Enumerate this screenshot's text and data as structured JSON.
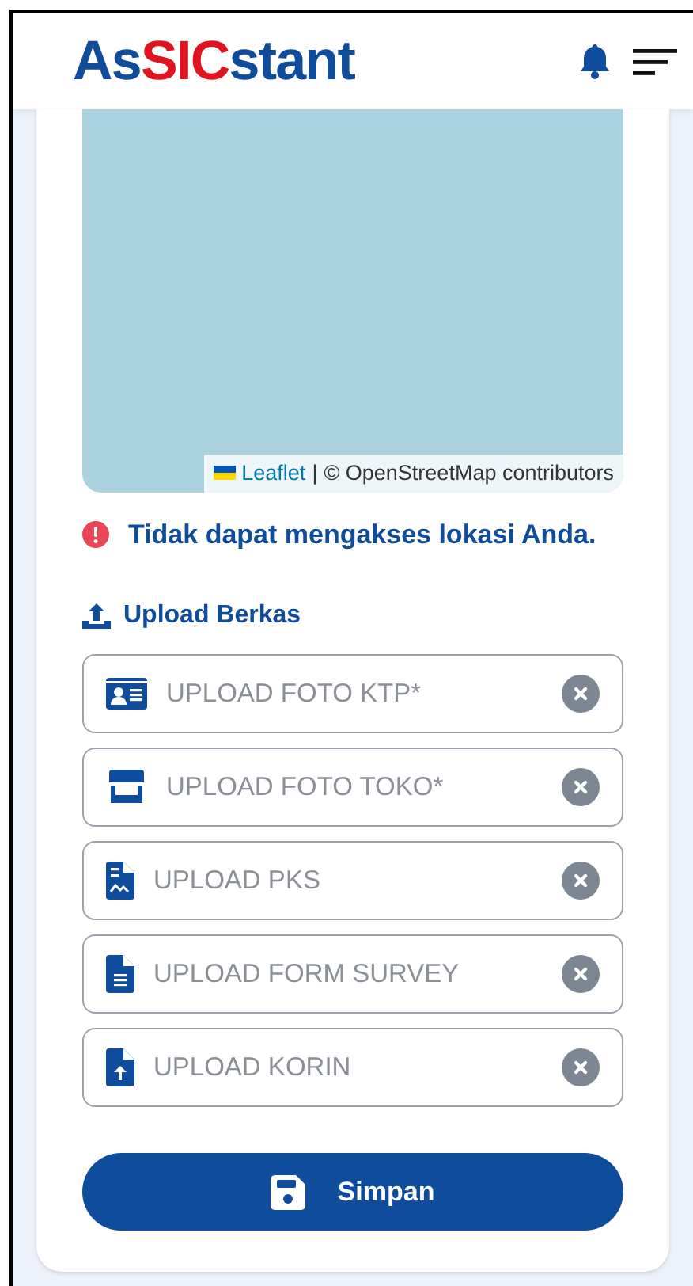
{
  "header": {
    "logo": [
      {
        "text": "As",
        "kind": "plain"
      },
      {
        "text": "SIC",
        "kind": "accent"
      },
      {
        "text": "stant",
        "kind": "plain"
      }
    ]
  },
  "map": {
    "attribution_link": "Leaflet",
    "attribution_separator": "|",
    "attribution_text": "© OpenStreetMap contributors"
  },
  "error": {
    "message": "Tidak dapat mengakses lokasi Anda."
  },
  "upload": {
    "title": "Upload Berkas",
    "fields": [
      {
        "kind": "id-card",
        "placeholder": "UPLOAD FOTO KTP*"
      },
      {
        "kind": "store",
        "placeholder": "UPLOAD FOTO TOKO*"
      },
      {
        "kind": "signature",
        "placeholder": "UPLOAD PKS"
      },
      {
        "kind": "document",
        "placeholder": "UPLOAD FORM SURVEY"
      },
      {
        "kind": "file-upload",
        "placeholder": "UPLOAD KORIN"
      }
    ]
  },
  "save_button": {
    "label": "Simpan"
  }
}
